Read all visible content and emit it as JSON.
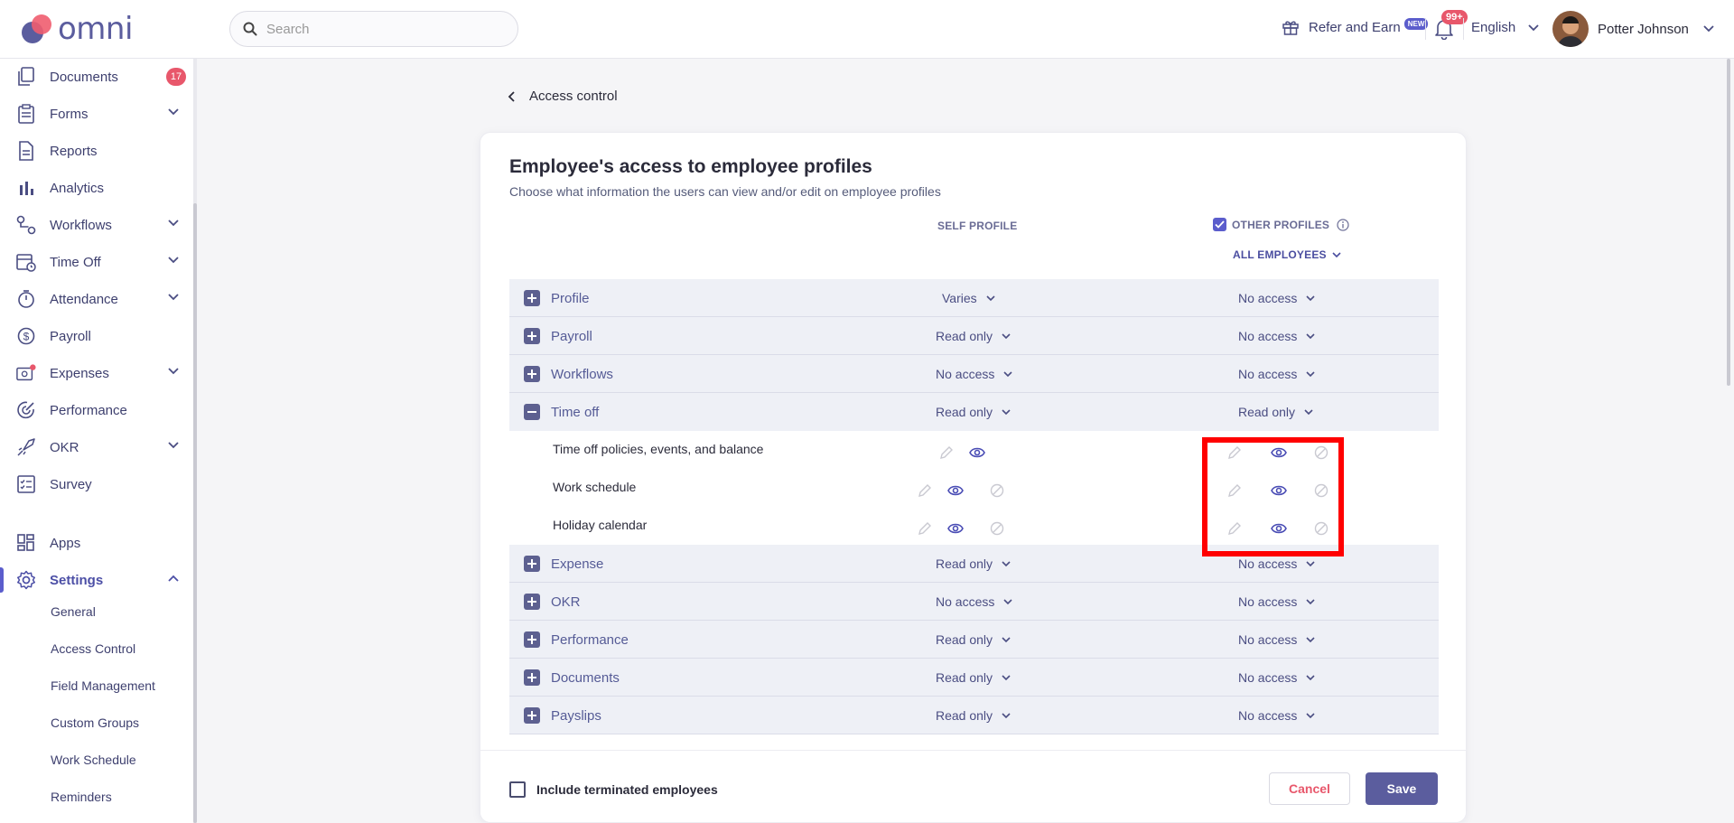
{
  "brand": {
    "name": "omni"
  },
  "header": {
    "search_placeholder": "Search",
    "refer_label": "Refer and Earn",
    "refer_badge": "NEW",
    "notifications_badge": "99+",
    "language": "English",
    "user_name": "Potter Johnson"
  },
  "sidebar": {
    "items": [
      {
        "label": "Documents",
        "icon": "documents-icon",
        "count": "17"
      },
      {
        "label": "Forms",
        "icon": "forms-icon"
      },
      {
        "label": "Reports",
        "icon": "reports-icon"
      },
      {
        "label": "Analytics",
        "icon": "analytics-icon"
      },
      {
        "label": "Workflows",
        "icon": "workflows-icon"
      },
      {
        "label": "Time Off",
        "icon": "calendar-clock-icon"
      },
      {
        "label": "Attendance",
        "icon": "stopwatch-icon"
      },
      {
        "label": "Payroll",
        "icon": "dollar-icon"
      },
      {
        "label": "Expenses",
        "icon": "expenses-icon"
      },
      {
        "label": "Performance",
        "icon": "target-icon"
      },
      {
        "label": "OKR",
        "icon": "rocket-icon"
      },
      {
        "label": "Survey",
        "icon": "survey-icon"
      },
      {
        "label": "Apps",
        "icon": "apps-icon"
      },
      {
        "label": "Settings",
        "icon": "gear-icon"
      }
    ],
    "settings_sub": [
      "General",
      "Access Control",
      "Field Management",
      "Custom Groups",
      "Work Schedule",
      "Reminders"
    ]
  },
  "main": {
    "back_label": "Access control",
    "title": "Employee's access to employee profiles",
    "subtitle": "Choose what information the users can view and/or edit on employee profiles",
    "self_col": "SELF PROFILE",
    "other_col": "OTHER PROFILES",
    "scope": "ALL EMPLOYEES",
    "rows": [
      {
        "name": "Profile",
        "self": "Varies",
        "other": "No access"
      },
      {
        "name": "Payroll",
        "self": "Read only",
        "other": "No access"
      },
      {
        "name": "Workflows",
        "self": "No access",
        "other": "No access"
      },
      {
        "name": "Time off",
        "self": "Read only",
        "other": "Read only",
        "expanded": true
      },
      {
        "name": "Expense",
        "self": "Read only",
        "other": "No access"
      },
      {
        "name": "OKR",
        "self": "No access",
        "other": "No access"
      },
      {
        "name": "Performance",
        "self": "Read only",
        "other": "No access"
      },
      {
        "name": "Documents",
        "self": "Read only",
        "other": "No access"
      },
      {
        "name": "Payslips",
        "self": "Read only",
        "other": "No access"
      }
    ],
    "time_off_sub": [
      {
        "name": "Time off policies, events, and balance",
        "self_perm": "view",
        "other_perm": "view"
      },
      {
        "name": "Work schedule",
        "self_perm": "view",
        "other_perm": "view"
      },
      {
        "name": "Holiday calendar",
        "self_perm": "view",
        "other_perm": "view"
      }
    ],
    "include_terminated": "Include terminated employees",
    "cancel": "Cancel",
    "save": "Save"
  },
  "colors": {
    "accent": "#5b5dcc",
    "brand": "#5b5d9e",
    "danger": "#e8576b",
    "row_bg": "#eef0f6"
  }
}
